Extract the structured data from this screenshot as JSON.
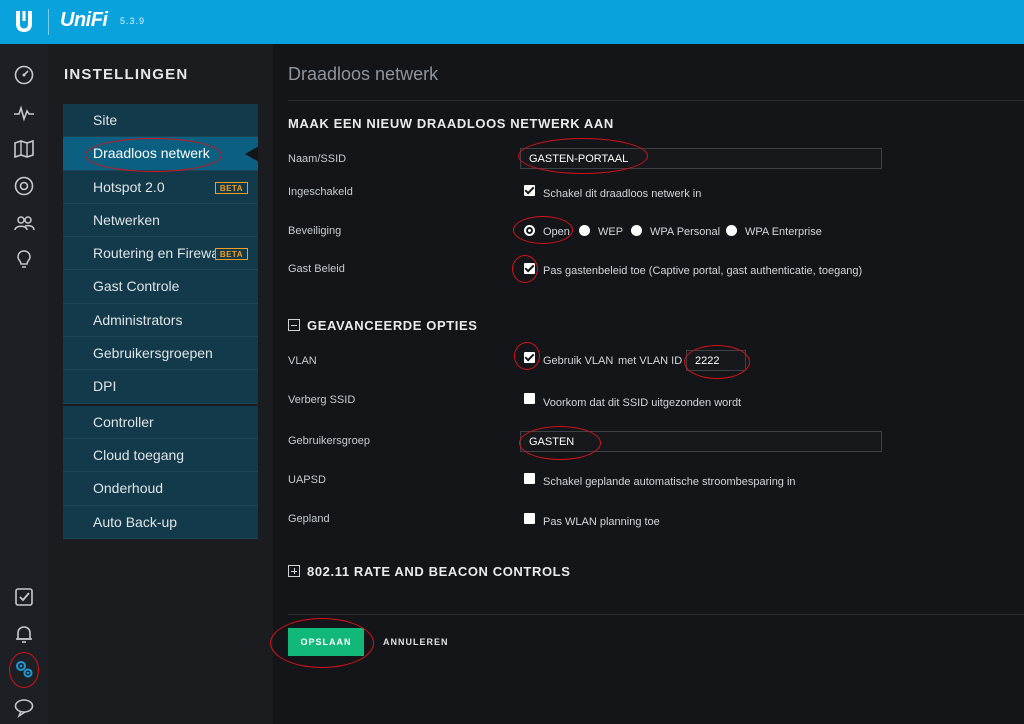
{
  "app": {
    "brand": "UniFi",
    "version": "5.3.9"
  },
  "rail": {
    "icons": [
      "dashboard-icon",
      "statistics-icon",
      "map-icon",
      "devices-icon",
      "clients-icon",
      "insights-icon",
      "events-icon",
      "alerts-icon",
      "settings-icon",
      "chat-icon"
    ]
  },
  "sidebar": {
    "title": "INSTELLINGEN",
    "group1": [
      {
        "label": "Site"
      },
      {
        "label": "Draadloos netwerk",
        "active": true
      },
      {
        "label": "Hotspot 2.0",
        "badge": "BETA"
      },
      {
        "label": "Netwerken"
      },
      {
        "label": "Routering en Firewall",
        "badge": "BETA"
      },
      {
        "label": "Gast Controle"
      },
      {
        "label": "Administrators"
      },
      {
        "label": "Gebruikersgroepen"
      },
      {
        "label": "DPI"
      }
    ],
    "group2": [
      {
        "label": "Controller"
      },
      {
        "label": "Cloud toegang"
      },
      {
        "label": "Onderhoud"
      },
      {
        "label": "Auto Back-up"
      }
    ]
  },
  "main": {
    "page_title": "Draadloos netwerk",
    "section_title": "MAAK EEN NIEUW DRAADLOOS NETWERK AAN",
    "ssid": {
      "label": "Naam/SSID",
      "value": "GASTEN-PORTAAL"
    },
    "enabled": {
      "label": "Ingeschakeld",
      "checkbox_label": "Schakel dit draadloos netwerk in",
      "checked": true
    },
    "security": {
      "label": "Beveiliging",
      "options": [
        "Open",
        "WEP",
        "WPA Personal",
        "WPA Enterprise"
      ],
      "selected": "Open"
    },
    "guest_policy": {
      "label": "Gast Beleid",
      "checkbox_label": "Pas gastenbeleid toe (Captive portal, gast authenticatie, toegang)",
      "checked": true
    },
    "advanced": {
      "title": "GEAVANCEERDE OPTIES",
      "vlan": {
        "label": "VLAN",
        "checkbox_label": "Gebruik VLAN",
        "vlan_id_label": "met VLAN ID",
        "vlan_id": "2222",
        "checked": true
      },
      "hide_ssid": {
        "label": "Verberg SSID",
        "checkbox_label": "Voorkom dat dit SSID uitgezonden wordt",
        "checked": false
      },
      "user_group": {
        "label": "Gebruikersgroep",
        "value": "GASTEN"
      },
      "uapsd": {
        "label": "UAPSD",
        "checkbox_label": "Schakel geplande automatische stroombesparing in",
        "checked": false
      },
      "scheduled": {
        "label": "Gepland",
        "checkbox_label": "Pas WLAN planning toe",
        "checked": false
      }
    },
    "rate_beacon": {
      "title": "802.11 RATE AND BEACON CONTROLS"
    },
    "actions": {
      "save": "OPSLAAN",
      "cancel": "ANNULEREN"
    }
  },
  "colors": {
    "topbar": "#0aa2dc",
    "save_button": "#12b77a",
    "annotation": "#d8121b",
    "beta": "#f0a020"
  }
}
